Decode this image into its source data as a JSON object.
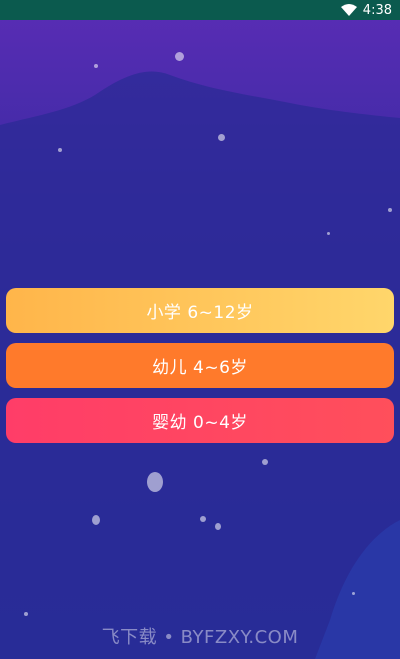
{
  "status_bar": {
    "time": "4:38",
    "wifi_icon": "wifi-icon",
    "background_color": "#0b5a4e"
  },
  "menu": {
    "items": [
      {
        "label": "小学 6~12岁",
        "color_start": "#ffb54a",
        "color_end": "#ffd66b"
      },
      {
        "label": "幼儿 4~6岁",
        "color_start": "#ff7a2b",
        "color_end": "#ff7a2b"
      },
      {
        "label": "婴幼 0~4岁",
        "color_start": "#ff3d68",
        "color_end": "#ff4f5b"
      }
    ]
  },
  "watermark": {
    "text": "飞下载 • BYFZXY.COM"
  },
  "background": {
    "colors": [
      "#5a2db5",
      "#3b2aa3",
      "#2b2d9c",
      "#22309a"
    ]
  }
}
